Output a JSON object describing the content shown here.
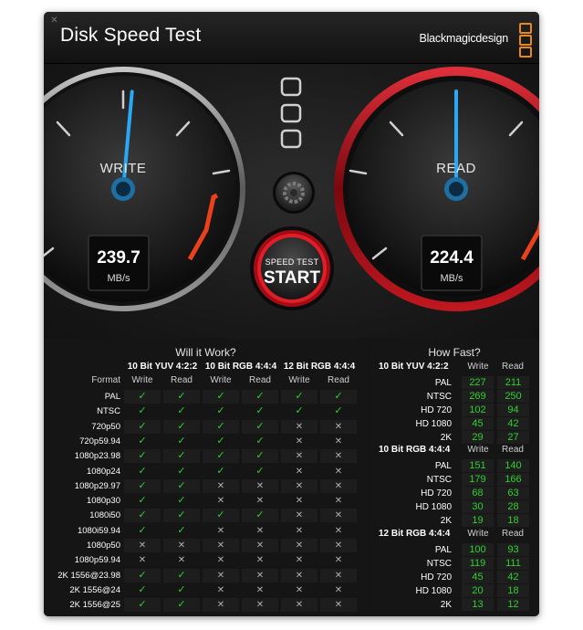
{
  "title": "Disk Speed Test",
  "brand": "Blackmagicdesign",
  "colors": {
    "accent_blue": "#2aa8f5",
    "read_ring": "#b4111a",
    "green": "#2fd12f",
    "redline": "#e8411b",
    "logo_orange": "#e8891e"
  },
  "icons": {
    "close": "close-icon",
    "logo": "blackmagic-logo-icon",
    "settings": "gear-icon",
    "check": "checkmark-icon",
    "cross": "cross-icon"
  },
  "write_gauge": {
    "label": "WRITE",
    "value": "239.7",
    "unit": "MB/s",
    "needle_fraction": 0.52
  },
  "read_gauge": {
    "label": "READ",
    "value": "224.4",
    "unit": "MB/s",
    "needle_fraction": 0.5
  },
  "start_button": {
    "top_label": "SPEED TEST",
    "main_label": "START"
  },
  "will_it_work": {
    "title": "Will it Work?",
    "format_header": "Format",
    "groups": [
      {
        "title": "10 Bit YUV 4:2:2",
        "write": "Write",
        "read": "Read"
      },
      {
        "title": "10 Bit RGB 4:4:4",
        "write": "Write",
        "read": "Read"
      },
      {
        "title": "12 Bit RGB 4:4:4",
        "write": "Write",
        "read": "Read"
      }
    ],
    "check_symbol": "✓",
    "cross_symbol": "✕",
    "rows": [
      {
        "format": "PAL",
        "results": [
          true,
          true,
          true,
          true,
          true,
          true
        ]
      },
      {
        "format": "NTSC",
        "results": [
          true,
          true,
          true,
          true,
          true,
          true
        ]
      },
      {
        "format": "720p50",
        "results": [
          true,
          true,
          true,
          true,
          false,
          false
        ]
      },
      {
        "format": "720p59.94",
        "results": [
          true,
          true,
          true,
          true,
          false,
          false
        ]
      },
      {
        "format": "1080p23.98",
        "results": [
          true,
          true,
          true,
          true,
          false,
          false
        ]
      },
      {
        "format": "1080p24",
        "results": [
          true,
          true,
          true,
          true,
          false,
          false
        ]
      },
      {
        "format": "1080p29.97",
        "results": [
          true,
          true,
          false,
          false,
          false,
          false
        ]
      },
      {
        "format": "1080p30",
        "results": [
          true,
          true,
          false,
          false,
          false,
          false
        ]
      },
      {
        "format": "1080i50",
        "results": [
          true,
          true,
          true,
          true,
          false,
          false
        ]
      },
      {
        "format": "1080i59.94",
        "results": [
          true,
          true,
          false,
          false,
          false,
          false
        ]
      },
      {
        "format": "1080p50",
        "results": [
          false,
          false,
          false,
          false,
          false,
          false
        ]
      },
      {
        "format": "1080p59.94",
        "results": [
          false,
          false,
          false,
          false,
          false,
          false
        ]
      },
      {
        "format": "2K 1556@23.98",
        "results": [
          true,
          true,
          false,
          false,
          false,
          false
        ]
      },
      {
        "format": "2K 1556@24",
        "results": [
          true,
          true,
          false,
          false,
          false,
          false
        ]
      },
      {
        "format": "2K 1556@25",
        "results": [
          true,
          true,
          false,
          false,
          false,
          false
        ]
      }
    ]
  },
  "how_fast": {
    "title": "How Fast?",
    "groups": [
      {
        "title": "10 Bit YUV 4:2:2",
        "write": "Write",
        "read": "Read",
        "rows": [
          {
            "format": "PAL",
            "write": "227",
            "read": "211"
          },
          {
            "format": "NTSC",
            "write": "269",
            "read": "250"
          },
          {
            "format": "HD 720",
            "write": "102",
            "read": "94"
          },
          {
            "format": "HD 1080",
            "write": "45",
            "read": "42"
          },
          {
            "format": "2K",
            "write": "29",
            "read": "27"
          }
        ]
      },
      {
        "title": "10 Bit RGB 4:4:4",
        "write": "Write",
        "read": "Read",
        "rows": [
          {
            "format": "PAL",
            "write": "151",
            "read": "140"
          },
          {
            "format": "NTSC",
            "write": "179",
            "read": "166"
          },
          {
            "format": "HD 720",
            "write": "68",
            "read": "63"
          },
          {
            "format": "HD 1080",
            "write": "30",
            "read": "28"
          },
          {
            "format": "2K",
            "write": "19",
            "read": "18"
          }
        ]
      },
      {
        "title": "12 Bit RGB 4:4:4",
        "write": "Write",
        "read": "Read",
        "rows": [
          {
            "format": "PAL",
            "write": "100",
            "read": "93"
          },
          {
            "format": "NTSC",
            "write": "119",
            "read": "111"
          },
          {
            "format": "HD 720",
            "write": "45",
            "read": "42"
          },
          {
            "format": "HD 1080",
            "write": "20",
            "read": "18"
          },
          {
            "format": "2K",
            "write": "13",
            "read": "12"
          }
        ]
      }
    ]
  }
}
